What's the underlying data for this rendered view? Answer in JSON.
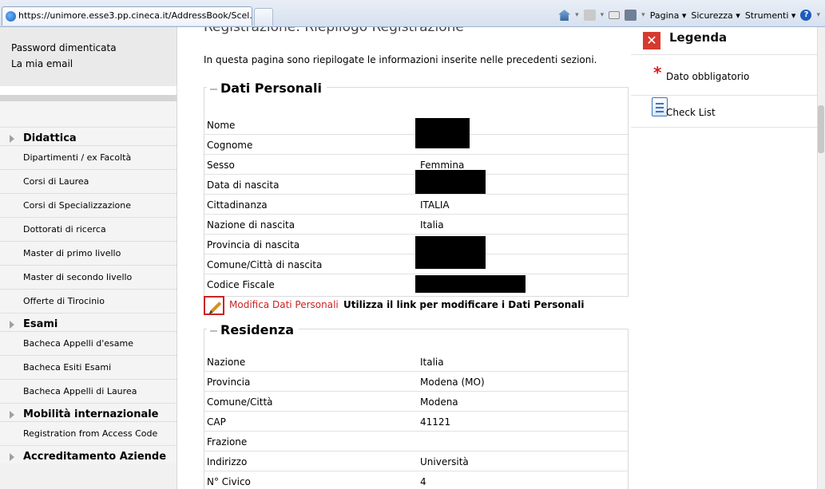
{
  "browser": {
    "tab_url": "https://unimore.esse3.pp.cineca.it/AddressBook/Scel...",
    "cmd_pagina": "Pagina",
    "cmd_sicurezza": "Sicurezza",
    "cmd_strumenti": "Strumenti"
  },
  "sidebar": {
    "top_links": [
      "Password dimenticata",
      "La mia email"
    ],
    "sections": [
      {
        "title": "Didattica",
        "items": [
          "Dipartimenti / ex Facoltà",
          "Corsi di Laurea",
          "Corsi di Specializzazione",
          "Dottorati di ricerca",
          "Master di primo livello",
          "Master di secondo livello",
          "Offerte di Tirocinio"
        ]
      },
      {
        "title": "Esami",
        "items": [
          "Bacheca Appelli d'esame",
          "Bacheca Esiti Esami",
          "Bacheca Appelli di Laurea"
        ]
      },
      {
        "title": "Mobilità internazionale",
        "items": [
          "Registration from Access Code"
        ]
      },
      {
        "title": "Accreditamento Aziende",
        "items": []
      }
    ]
  },
  "main": {
    "page_title": "Registrazione: Riepilogo Registrazione",
    "intro": "In questa pagina sono riepilogate le informazioni inserite nelle precedenti sezioni.",
    "personal": {
      "legend": "Dati Personali",
      "rows": [
        {
          "label": "Nome",
          "value": ""
        },
        {
          "label": "Cognome",
          "value": ""
        },
        {
          "label": "Sesso",
          "value": "Femmina"
        },
        {
          "label": "Data di nascita",
          "value": ""
        },
        {
          "label": "Cittadinanza",
          "value": "ITALIA"
        },
        {
          "label": "Nazione di nascita",
          "value": "Italia"
        },
        {
          "label": "Provincia di nascita",
          "value": ""
        },
        {
          "label": "Comune/Città di nascita",
          "value": ""
        },
        {
          "label": "Codice Fiscale",
          "value": ""
        }
      ]
    },
    "modify_link": "Modifica Dati Personali",
    "modify_hint": "Utilizza il link per modificare i Dati Personali",
    "residence": {
      "legend": "Residenza",
      "rows": [
        {
          "label": "Nazione",
          "value": "Italia"
        },
        {
          "label": "Provincia",
          "value": "Modena (MO)"
        },
        {
          "label": "Comune/Città",
          "value": "Modena"
        },
        {
          "label": "CAP",
          "value": "41121"
        },
        {
          "label": "Frazione",
          "value": ""
        },
        {
          "label": "Indirizzo",
          "value": "Università"
        },
        {
          "label": "N° Civico",
          "value": "4"
        }
      ]
    }
  },
  "right_panel": {
    "legend_title": "Legenda",
    "required_label": "Dato obbligatorio",
    "checklist_label": "Check List"
  }
}
